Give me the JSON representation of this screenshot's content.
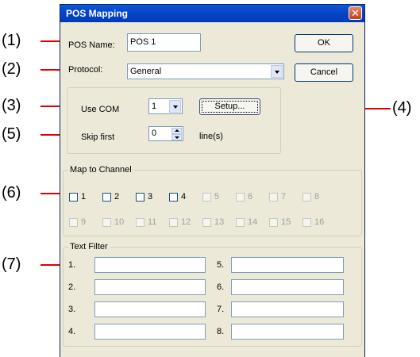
{
  "window": {
    "title": "POS Mapping"
  },
  "callouts": [
    "(1)",
    "(2)",
    "(3)",
    "(4)",
    "(5)",
    "(6)",
    "(7)"
  ],
  "pos_name": {
    "label": "POS Name:",
    "value": "POS 1"
  },
  "protocol": {
    "label": "Protocol:",
    "value": "General"
  },
  "buttons": {
    "ok": "OK",
    "cancel": "Cancel",
    "setup": "Setup..."
  },
  "com": {
    "label": "Use  COM",
    "value": "1"
  },
  "skip": {
    "label": "Skip  first",
    "value": "0",
    "unit": "line(s)"
  },
  "map_channel": {
    "legend": "Map to Channel",
    "channels": [
      "1",
      "2",
      "3",
      "4",
      "5",
      "6",
      "7",
      "8",
      "9",
      "10",
      "11",
      "12",
      "13",
      "14",
      "15",
      "16"
    ],
    "enabled_count": 4
  },
  "text_filter": {
    "legend": "Text Filter",
    "labels": [
      "1.",
      "2.",
      "3.",
      "4.",
      "5.",
      "6.",
      "7.",
      "8."
    ]
  },
  "colors": {
    "callout_line": "#e00000",
    "titlebar": "#0846c8",
    "dialog_bg": "#ece9d8"
  }
}
